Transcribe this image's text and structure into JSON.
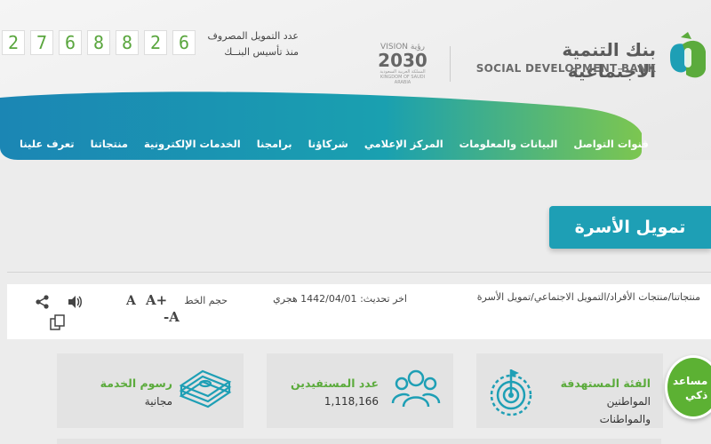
{
  "header": {
    "counter_digits": [
      "2",
      "7",
      "6",
      "8",
      "8",
      "2",
      "6"
    ],
    "counter_label_line1": "عدد التمويل المصروف",
    "counter_label_line2": "منذ تأسيس البنــك",
    "vision_label": "VISION رؤية",
    "vision_year": "2030",
    "vision_caption": "المملكة العربية السعودية KINGDOM OF SAUDI ARABIA",
    "bank_name_ar": "بنك التنمية الاجتماعية",
    "bank_name_en": "SOCIAL DEVELOPMENT BANK"
  },
  "nav": {
    "items": [
      "تعرف علينا",
      "منتجاتنا",
      "الخدمات الإلكترونية",
      "برامجنا",
      "شركاؤنا",
      "المركز الإعلامي",
      "البيانات والمعلومات",
      "قنوات التواصل"
    ]
  },
  "page": {
    "title": "تمويل الأسرة"
  },
  "infobar": {
    "breadcrumb": "منتجاتنا/منتجات الأفراد/التمويل الاجتماعي/تمويل الأسرة",
    "updated_label": "اخر تحديث:",
    "updated_date": "1442/04/01 هجري",
    "font_size_label": "حجم الخط",
    "font_increase": "A+",
    "font_normal": "A",
    "font_decrease": "-A"
  },
  "cards": [
    {
      "label": "الفئة المستهدفة",
      "value_line1": "المواطنين",
      "value_line2": "والمواطنات",
      "icon": "target-icon"
    },
    {
      "label": "عدد المستفيدين",
      "value_line1": "1,118,166",
      "value_line2": "",
      "icon": "people-icon"
    },
    {
      "label": "رسوم الخدمة",
      "value_line1": "مجانية",
      "value_line2": "",
      "icon": "money-stack-icon"
    }
  ],
  "assistant": {
    "line1": "مساعد",
    "line2": "ذكي"
  },
  "colors": {
    "brand_teal": "#1e9fb5",
    "brand_green": "#5bab3c",
    "nav_gradient_start": "#1b8fb8",
    "nav_gradient_end": "#6cc04a"
  }
}
